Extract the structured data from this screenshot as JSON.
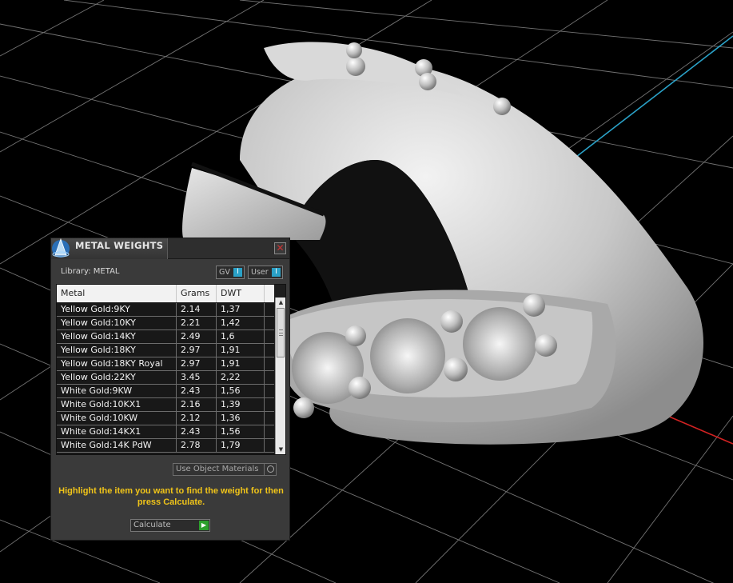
{
  "panel": {
    "title": "METAL WEIGHTS",
    "close_glyph": "✕",
    "library_label": "Library: METAL",
    "gv_label": "GV",
    "user_label": "User",
    "toggle_glyph": "I",
    "use_object_materials": "Use Object Materials",
    "instructions": "Highlight the item you want to find the weight for then press Calculate.",
    "calculate_label": "Calculate",
    "calculate_glyph": "▶"
  },
  "table": {
    "columns": [
      "Metal",
      "Grams",
      "DWT"
    ],
    "rows": [
      {
        "metal": "Yellow Gold:9KY",
        "grams": "2.14",
        "dwt": "1,37"
      },
      {
        "metal": "Yellow Gold:10KY",
        "grams": "2.21",
        "dwt": "1,42"
      },
      {
        "metal": "Yellow Gold:14KY",
        "grams": "2.49",
        "dwt": "1,6"
      },
      {
        "metal": "Yellow Gold:18KY",
        "grams": "2.97",
        "dwt": "1,91"
      },
      {
        "metal": "Yellow Gold:18KY Royal",
        "grams": "2.97",
        "dwt": "1,91"
      },
      {
        "metal": "Yellow Gold:22KY",
        "grams": "3.45",
        "dwt": "2,22"
      },
      {
        "metal": "White Gold:9KW",
        "grams": "2.43",
        "dwt": "1,56"
      },
      {
        "metal": "White Gold:10KX1",
        "grams": "2.16",
        "dwt": "1,39"
      },
      {
        "metal": "White Gold:10KW",
        "grams": "2.12",
        "dwt": "1,36"
      },
      {
        "metal": "White Gold:14KX1",
        "grams": "2.43",
        "dwt": "1,56"
      },
      {
        "metal": "White Gold:14K PdW",
        "grams": "2.78",
        "dwt": "1,79"
      }
    ]
  },
  "colors": {
    "grid": "#9a9a9a",
    "axis_blue": "#2aa1c7",
    "axis_red": "#d22222",
    "highlight_text": "#f0c419"
  }
}
